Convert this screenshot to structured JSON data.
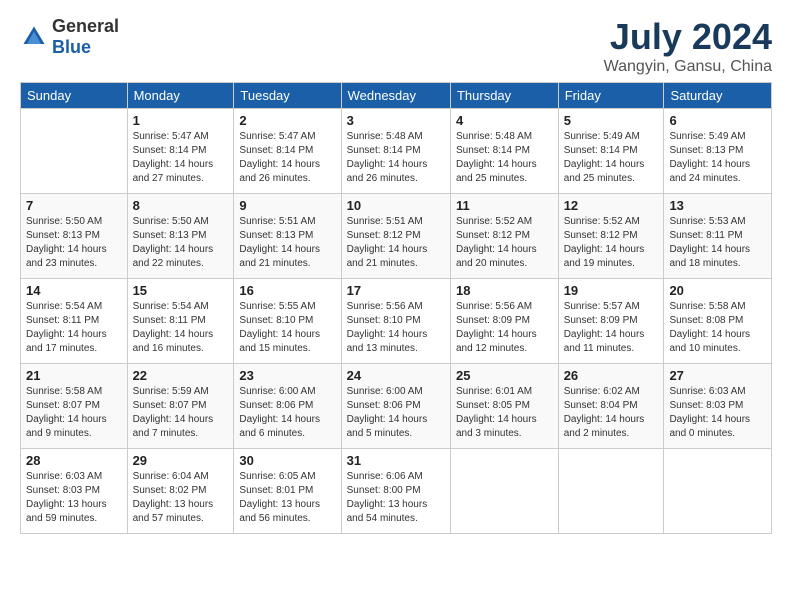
{
  "header": {
    "logo_general": "General",
    "logo_blue": "Blue",
    "title": "July 2024",
    "subtitle": "Wangyin, Gansu, China"
  },
  "days_of_week": [
    "Sunday",
    "Monday",
    "Tuesday",
    "Wednesday",
    "Thursday",
    "Friday",
    "Saturday"
  ],
  "weeks": [
    [
      {
        "day": "",
        "info": ""
      },
      {
        "day": "1",
        "info": "Sunrise: 5:47 AM\nSunset: 8:14 PM\nDaylight: 14 hours\nand 27 minutes."
      },
      {
        "day": "2",
        "info": "Sunrise: 5:47 AM\nSunset: 8:14 PM\nDaylight: 14 hours\nand 26 minutes."
      },
      {
        "day": "3",
        "info": "Sunrise: 5:48 AM\nSunset: 8:14 PM\nDaylight: 14 hours\nand 26 minutes."
      },
      {
        "day": "4",
        "info": "Sunrise: 5:48 AM\nSunset: 8:14 PM\nDaylight: 14 hours\nand 25 minutes."
      },
      {
        "day": "5",
        "info": "Sunrise: 5:49 AM\nSunset: 8:14 PM\nDaylight: 14 hours\nand 25 minutes."
      },
      {
        "day": "6",
        "info": "Sunrise: 5:49 AM\nSunset: 8:13 PM\nDaylight: 14 hours\nand 24 minutes."
      }
    ],
    [
      {
        "day": "7",
        "info": "Sunrise: 5:50 AM\nSunset: 8:13 PM\nDaylight: 14 hours\nand 23 minutes."
      },
      {
        "day": "8",
        "info": "Sunrise: 5:50 AM\nSunset: 8:13 PM\nDaylight: 14 hours\nand 22 minutes."
      },
      {
        "day": "9",
        "info": "Sunrise: 5:51 AM\nSunset: 8:13 PM\nDaylight: 14 hours\nand 21 minutes."
      },
      {
        "day": "10",
        "info": "Sunrise: 5:51 AM\nSunset: 8:12 PM\nDaylight: 14 hours\nand 21 minutes."
      },
      {
        "day": "11",
        "info": "Sunrise: 5:52 AM\nSunset: 8:12 PM\nDaylight: 14 hours\nand 20 minutes."
      },
      {
        "day": "12",
        "info": "Sunrise: 5:52 AM\nSunset: 8:12 PM\nDaylight: 14 hours\nand 19 minutes."
      },
      {
        "day": "13",
        "info": "Sunrise: 5:53 AM\nSunset: 8:11 PM\nDaylight: 14 hours\nand 18 minutes."
      }
    ],
    [
      {
        "day": "14",
        "info": "Sunrise: 5:54 AM\nSunset: 8:11 PM\nDaylight: 14 hours\nand 17 minutes."
      },
      {
        "day": "15",
        "info": "Sunrise: 5:54 AM\nSunset: 8:11 PM\nDaylight: 14 hours\nand 16 minutes."
      },
      {
        "day": "16",
        "info": "Sunrise: 5:55 AM\nSunset: 8:10 PM\nDaylight: 14 hours\nand 15 minutes."
      },
      {
        "day": "17",
        "info": "Sunrise: 5:56 AM\nSunset: 8:10 PM\nDaylight: 14 hours\nand 13 minutes."
      },
      {
        "day": "18",
        "info": "Sunrise: 5:56 AM\nSunset: 8:09 PM\nDaylight: 14 hours\nand 12 minutes."
      },
      {
        "day": "19",
        "info": "Sunrise: 5:57 AM\nSunset: 8:09 PM\nDaylight: 14 hours\nand 11 minutes."
      },
      {
        "day": "20",
        "info": "Sunrise: 5:58 AM\nSunset: 8:08 PM\nDaylight: 14 hours\nand 10 minutes."
      }
    ],
    [
      {
        "day": "21",
        "info": "Sunrise: 5:58 AM\nSunset: 8:07 PM\nDaylight: 14 hours\nand 9 minutes."
      },
      {
        "day": "22",
        "info": "Sunrise: 5:59 AM\nSunset: 8:07 PM\nDaylight: 14 hours\nand 7 minutes."
      },
      {
        "day": "23",
        "info": "Sunrise: 6:00 AM\nSunset: 8:06 PM\nDaylight: 14 hours\nand 6 minutes."
      },
      {
        "day": "24",
        "info": "Sunrise: 6:00 AM\nSunset: 8:06 PM\nDaylight: 14 hours\nand 5 minutes."
      },
      {
        "day": "25",
        "info": "Sunrise: 6:01 AM\nSunset: 8:05 PM\nDaylight: 14 hours\nand 3 minutes."
      },
      {
        "day": "26",
        "info": "Sunrise: 6:02 AM\nSunset: 8:04 PM\nDaylight: 14 hours\nand 2 minutes."
      },
      {
        "day": "27",
        "info": "Sunrise: 6:03 AM\nSunset: 8:03 PM\nDaylight: 14 hours\nand 0 minutes."
      }
    ],
    [
      {
        "day": "28",
        "info": "Sunrise: 6:03 AM\nSunset: 8:03 PM\nDaylight: 13 hours\nand 59 minutes."
      },
      {
        "day": "29",
        "info": "Sunrise: 6:04 AM\nSunset: 8:02 PM\nDaylight: 13 hours\nand 57 minutes."
      },
      {
        "day": "30",
        "info": "Sunrise: 6:05 AM\nSunset: 8:01 PM\nDaylight: 13 hours\nand 56 minutes."
      },
      {
        "day": "31",
        "info": "Sunrise: 6:06 AM\nSunset: 8:00 PM\nDaylight: 13 hours\nand 54 minutes."
      },
      {
        "day": "",
        "info": ""
      },
      {
        "day": "",
        "info": ""
      },
      {
        "day": "",
        "info": ""
      }
    ]
  ]
}
